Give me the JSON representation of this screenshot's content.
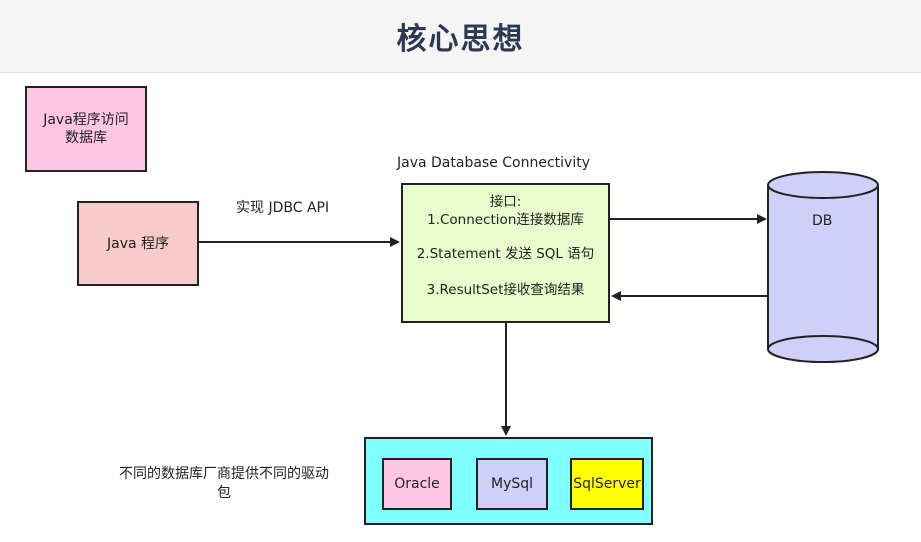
{
  "header": {
    "title": "核心思想"
  },
  "diagram": {
    "note_box": {
      "line1": "Java程序访问",
      "line2": "数据库"
    },
    "java_program": {
      "label": "Java 程序"
    },
    "implement_label": "实现 JDBC API",
    "jdbc_title": "Java Database Connectivity",
    "jdbc_box": {
      "line1": "接口:",
      "line2": "1.Connection连接数据库",
      "line3": "2.Statement 发送 SQL 语句",
      "line4": "3.ResultSet接收查询结果"
    },
    "database": {
      "label": "DB"
    },
    "vendor_label": "不同的数据库厂商提供不同的驱动包",
    "drivers": {
      "oracle": "Oracle",
      "mysql": "MySql",
      "sqlserver": "SqlServer"
    }
  },
  "colors": {
    "note_fill": "#ffc6e3",
    "java_fill": "#f8cbcb",
    "jdbc_fill": "#e9fccd",
    "db_fill": "#cfcff8",
    "drivers_fill": "#80ffff",
    "sqlserver_fill": "#ffff00"
  }
}
